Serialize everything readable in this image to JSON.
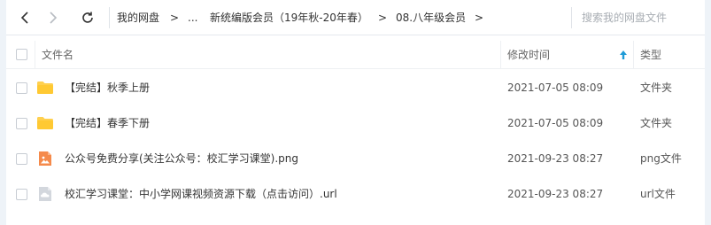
{
  "toolbar": {
    "back_icon": "chevron-left-icon",
    "forward_icon": "chevron-right-icon",
    "refresh_icon": "refresh-icon",
    "breadcrumb": [
      {
        "label": "我的网盘"
      },
      {
        "label": "..."
      },
      {
        "label": "新统编版会员（19年秋-20年春）"
      },
      {
        "label": "08.八年级会员"
      }
    ],
    "separator": ">",
    "search_placeholder": "搜索我的网盘文件"
  },
  "header": {
    "name_label": "文件名",
    "time_label": "修改时间",
    "type_label": "类型",
    "sort_icon": "arrow-up-icon",
    "sort_color": "#1e9bd7"
  },
  "files": [
    {
      "name": "【完结】秋季上册",
      "time": "2021-07-05 08:09",
      "type": "文件夹",
      "icon": "folder-icon"
    },
    {
      "name": "【完结】春季下册",
      "time": "2021-07-05 08:09",
      "type": "文件夹",
      "icon": "folder-icon"
    },
    {
      "name": "公众号免费分享(关注公众号：校汇学习课堂).png",
      "time": "2021-09-23 08:27",
      "type": "png文件",
      "icon": "image-file-icon"
    },
    {
      "name": "校汇学习课堂：中小学网课视频资源下载（点击访问）.url",
      "time": "2021-09-23 08:27",
      "type": "url文件",
      "icon": "link-file-icon"
    }
  ],
  "colors": {
    "folder": "#ffd04f",
    "image_file": "#f58a4b",
    "link_file": "#c9ced6"
  }
}
